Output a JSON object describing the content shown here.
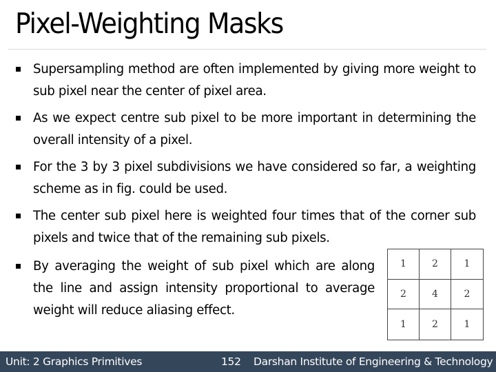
{
  "slide": {
    "title": "Pixel-Weighting Masks",
    "bullets": [
      "Supersampling method are often implemented by giving more weight to sub pixel near the center of pixel area.",
      "As we expect centre sub pixel to be more important in determining the overall intensity of a pixel.",
      "For the 3 by 3 pixel subdivisions we have considered so far, a weighting scheme as in fig. could be used.",
      "The center sub pixel here is weighted four times that of the corner sub pixels and twice that of the remaining sub pixels.",
      "By averaging the weight of sub pixel which are along the line and assign intensity proportional to average weight will reduce aliasing effect."
    ],
    "bullet_icon": "square-bullet-icon",
    "weight_mask": [
      [
        "1",
        "2",
        "1"
      ],
      [
        "2",
        "4",
        "2"
      ],
      [
        "1",
        "2",
        "1"
      ]
    ]
  },
  "footer": {
    "unit": "Unit: 2 Graphics Primitives",
    "page_number": "152",
    "institute": "Darshan Institute of Engineering & Technology",
    "background_color": "#34465a"
  }
}
